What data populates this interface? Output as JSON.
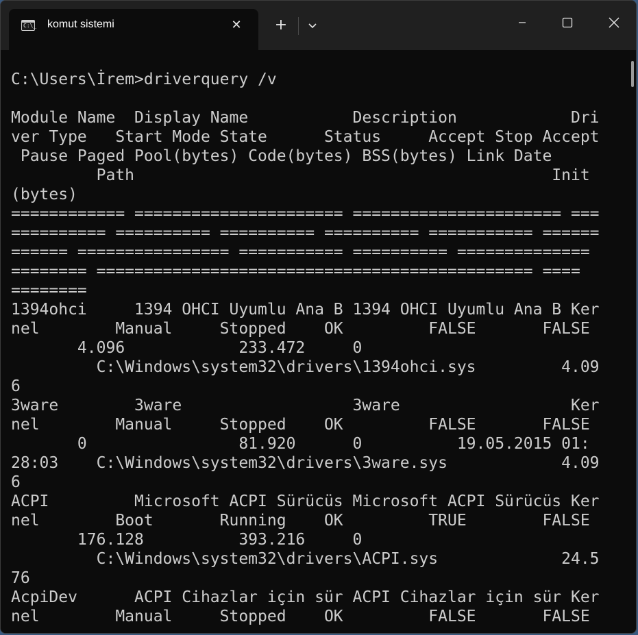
{
  "window": {
    "tab_title": "komut sistemi",
    "tab_icon": "terminal-icon",
    "tab_icon_prompt": "C:\\_",
    "new_tab_glyph": "+",
    "tab_close_glyph": "✕"
  },
  "terminal": {
    "lines": [
      "C:\\Users\\İrem>driverquery /v",
      "",
      "Module Name  Display Name           Description            Dri",
      "ver Type   Start Mode State      Status     Accept Stop Accept",
      " Pause Paged Pool(bytes) Code(bytes) BSS(bytes) Link Date",
      "         Path                                            Init",
      "(bytes)",
      "============ ====================== ====================== ===",
      "========== ========== ========== ========== =========== ======",
      "====== ================ =========== ========== ==============",
      "======== ============================================== ====",
      "========",
      "1394ohci     1394 OHCI Uyumlu Ana B 1394 OHCI Uyumlu Ana B Ker",
      "nel        Manual     Stopped    OK         FALSE       FALSE",
      "       4.096            233.472     0",
      "         C:\\Windows\\system32\\drivers\\1394ohci.sys         4.09",
      "6",
      "3ware        3ware                  3ware                  Ker",
      "nel        Manual     Stopped    OK         FALSE       FALSE",
      "       0                81.920      0          19.05.2015 01:",
      "28:03    C:\\Windows\\system32\\drivers\\3ware.sys            4.09",
      "6",
      "ACPI         Microsoft ACPI Sürücüs Microsoft ACPI Sürücüs Ker",
      "nel        Boot       Running    OK         TRUE        FALSE",
      "       176.128          393.216     0",
      "         C:\\Windows\\system32\\drivers\\ACPI.sys             24.5",
      "76",
      "AcpiDev      ACPI Cihazlar için sür ACPI Cihazlar için sür Ker",
      "nel        Manual     Stopped    OK         FALSE       FALSE"
    ]
  }
}
